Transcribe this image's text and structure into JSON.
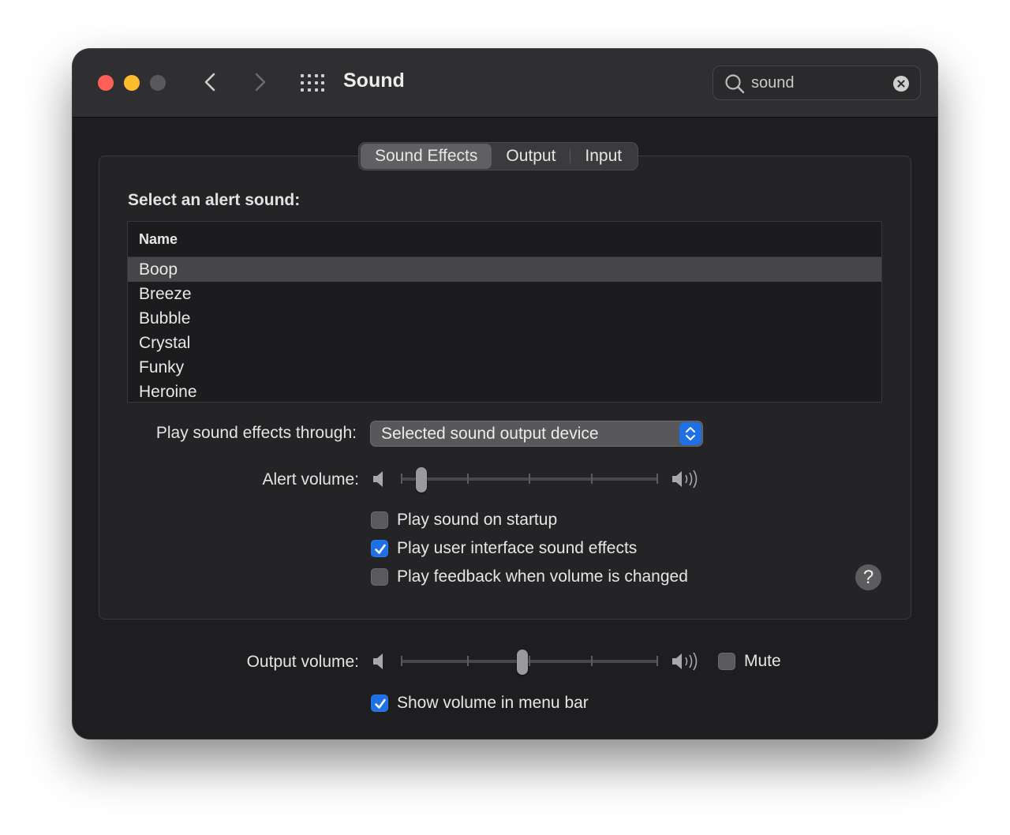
{
  "window": {
    "title": "Sound"
  },
  "search": {
    "value": "sound",
    "placeholder": "Search"
  },
  "tabs": [
    {
      "label": "Sound Effects",
      "active": true
    },
    {
      "label": "Output",
      "active": false
    },
    {
      "label": "Input",
      "active": false
    }
  ],
  "alert_section": {
    "label": "Select an alert sound:",
    "column_header": "Name",
    "sounds": [
      "Boop",
      "Breeze",
      "Bubble",
      "Crystal",
      "Funky",
      "Heroine"
    ],
    "selected": "Boop"
  },
  "play_through": {
    "label": "Play sound effects through:",
    "value": "Selected sound output device"
  },
  "alert_volume": {
    "label": "Alert volume:",
    "level": 0.06
  },
  "options": {
    "startup": {
      "label": "Play sound on startup",
      "checked": false
    },
    "ui_effects": {
      "label": "Play user interface sound effects",
      "checked": true
    },
    "feedback": {
      "label": "Play feedback when volume is changed",
      "checked": false
    }
  },
  "help": {
    "label": "?"
  },
  "output_volume": {
    "label": "Output volume:",
    "level": 0.47,
    "mute_label": "Mute",
    "muted": false
  },
  "menu_bar": {
    "label": "Show volume in menu bar",
    "checked": true
  },
  "colors": {
    "accent": "#1f6fe5",
    "close": "#fe5f57",
    "minimize": "#febc2e"
  }
}
